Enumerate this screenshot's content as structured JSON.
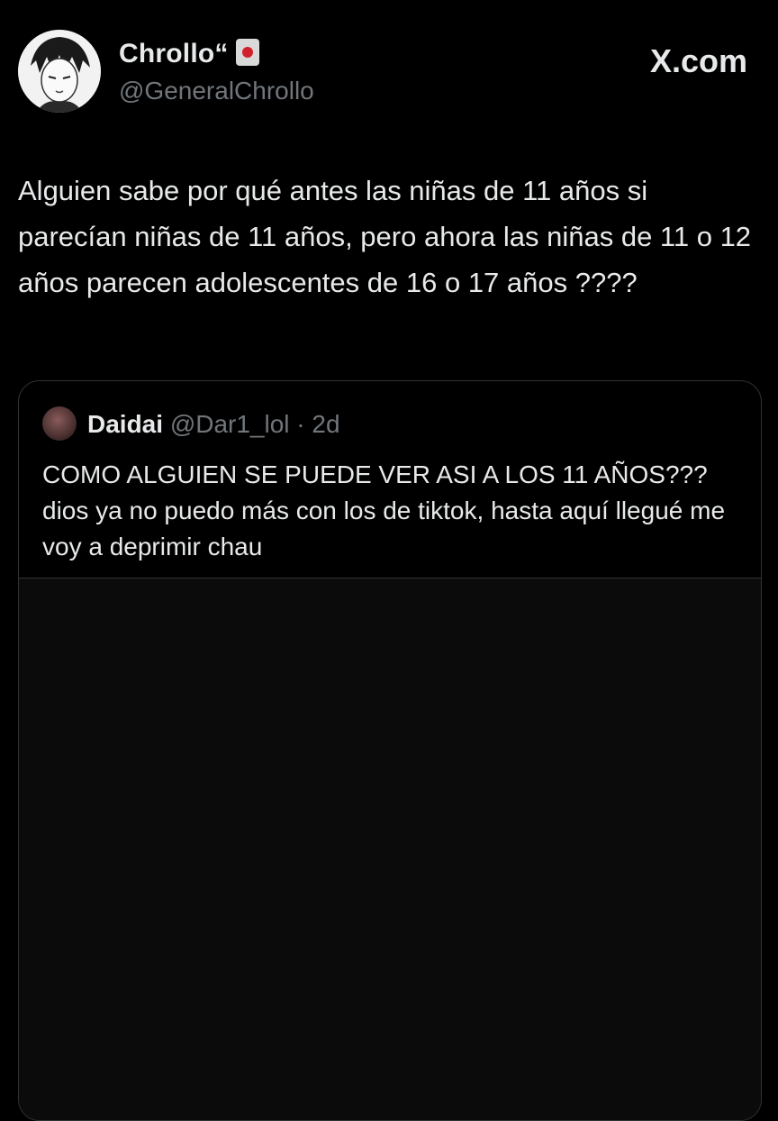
{
  "header": {
    "display_name": "Chrollo“",
    "handle": "@GeneralChrollo",
    "badge_icon": "hanafuda-card-icon",
    "brand": "X.com"
  },
  "tweet": {
    "text": "Alguien sabe por qué antes las niñas de 11 años si parecían niñas de 11 años, pero ahora las niñas de 11 o 12 años parecen adolescentes de 16 o 17 años ????"
  },
  "quoted": {
    "display_name": "Daidai",
    "handle": "@Dar1_lol",
    "separator": "·",
    "time": "2d",
    "text": "COMO ALGUIEN SE PUEDE VER ASI A LOS 11 AÑOS??? dios ya no puedo más con los de tiktok, hasta aquí llegué me voy a deprimir chau"
  },
  "colors": {
    "background": "#000000",
    "text_primary": "#e7e9ea",
    "text_secondary": "#71767b",
    "border": "#2f3336"
  }
}
